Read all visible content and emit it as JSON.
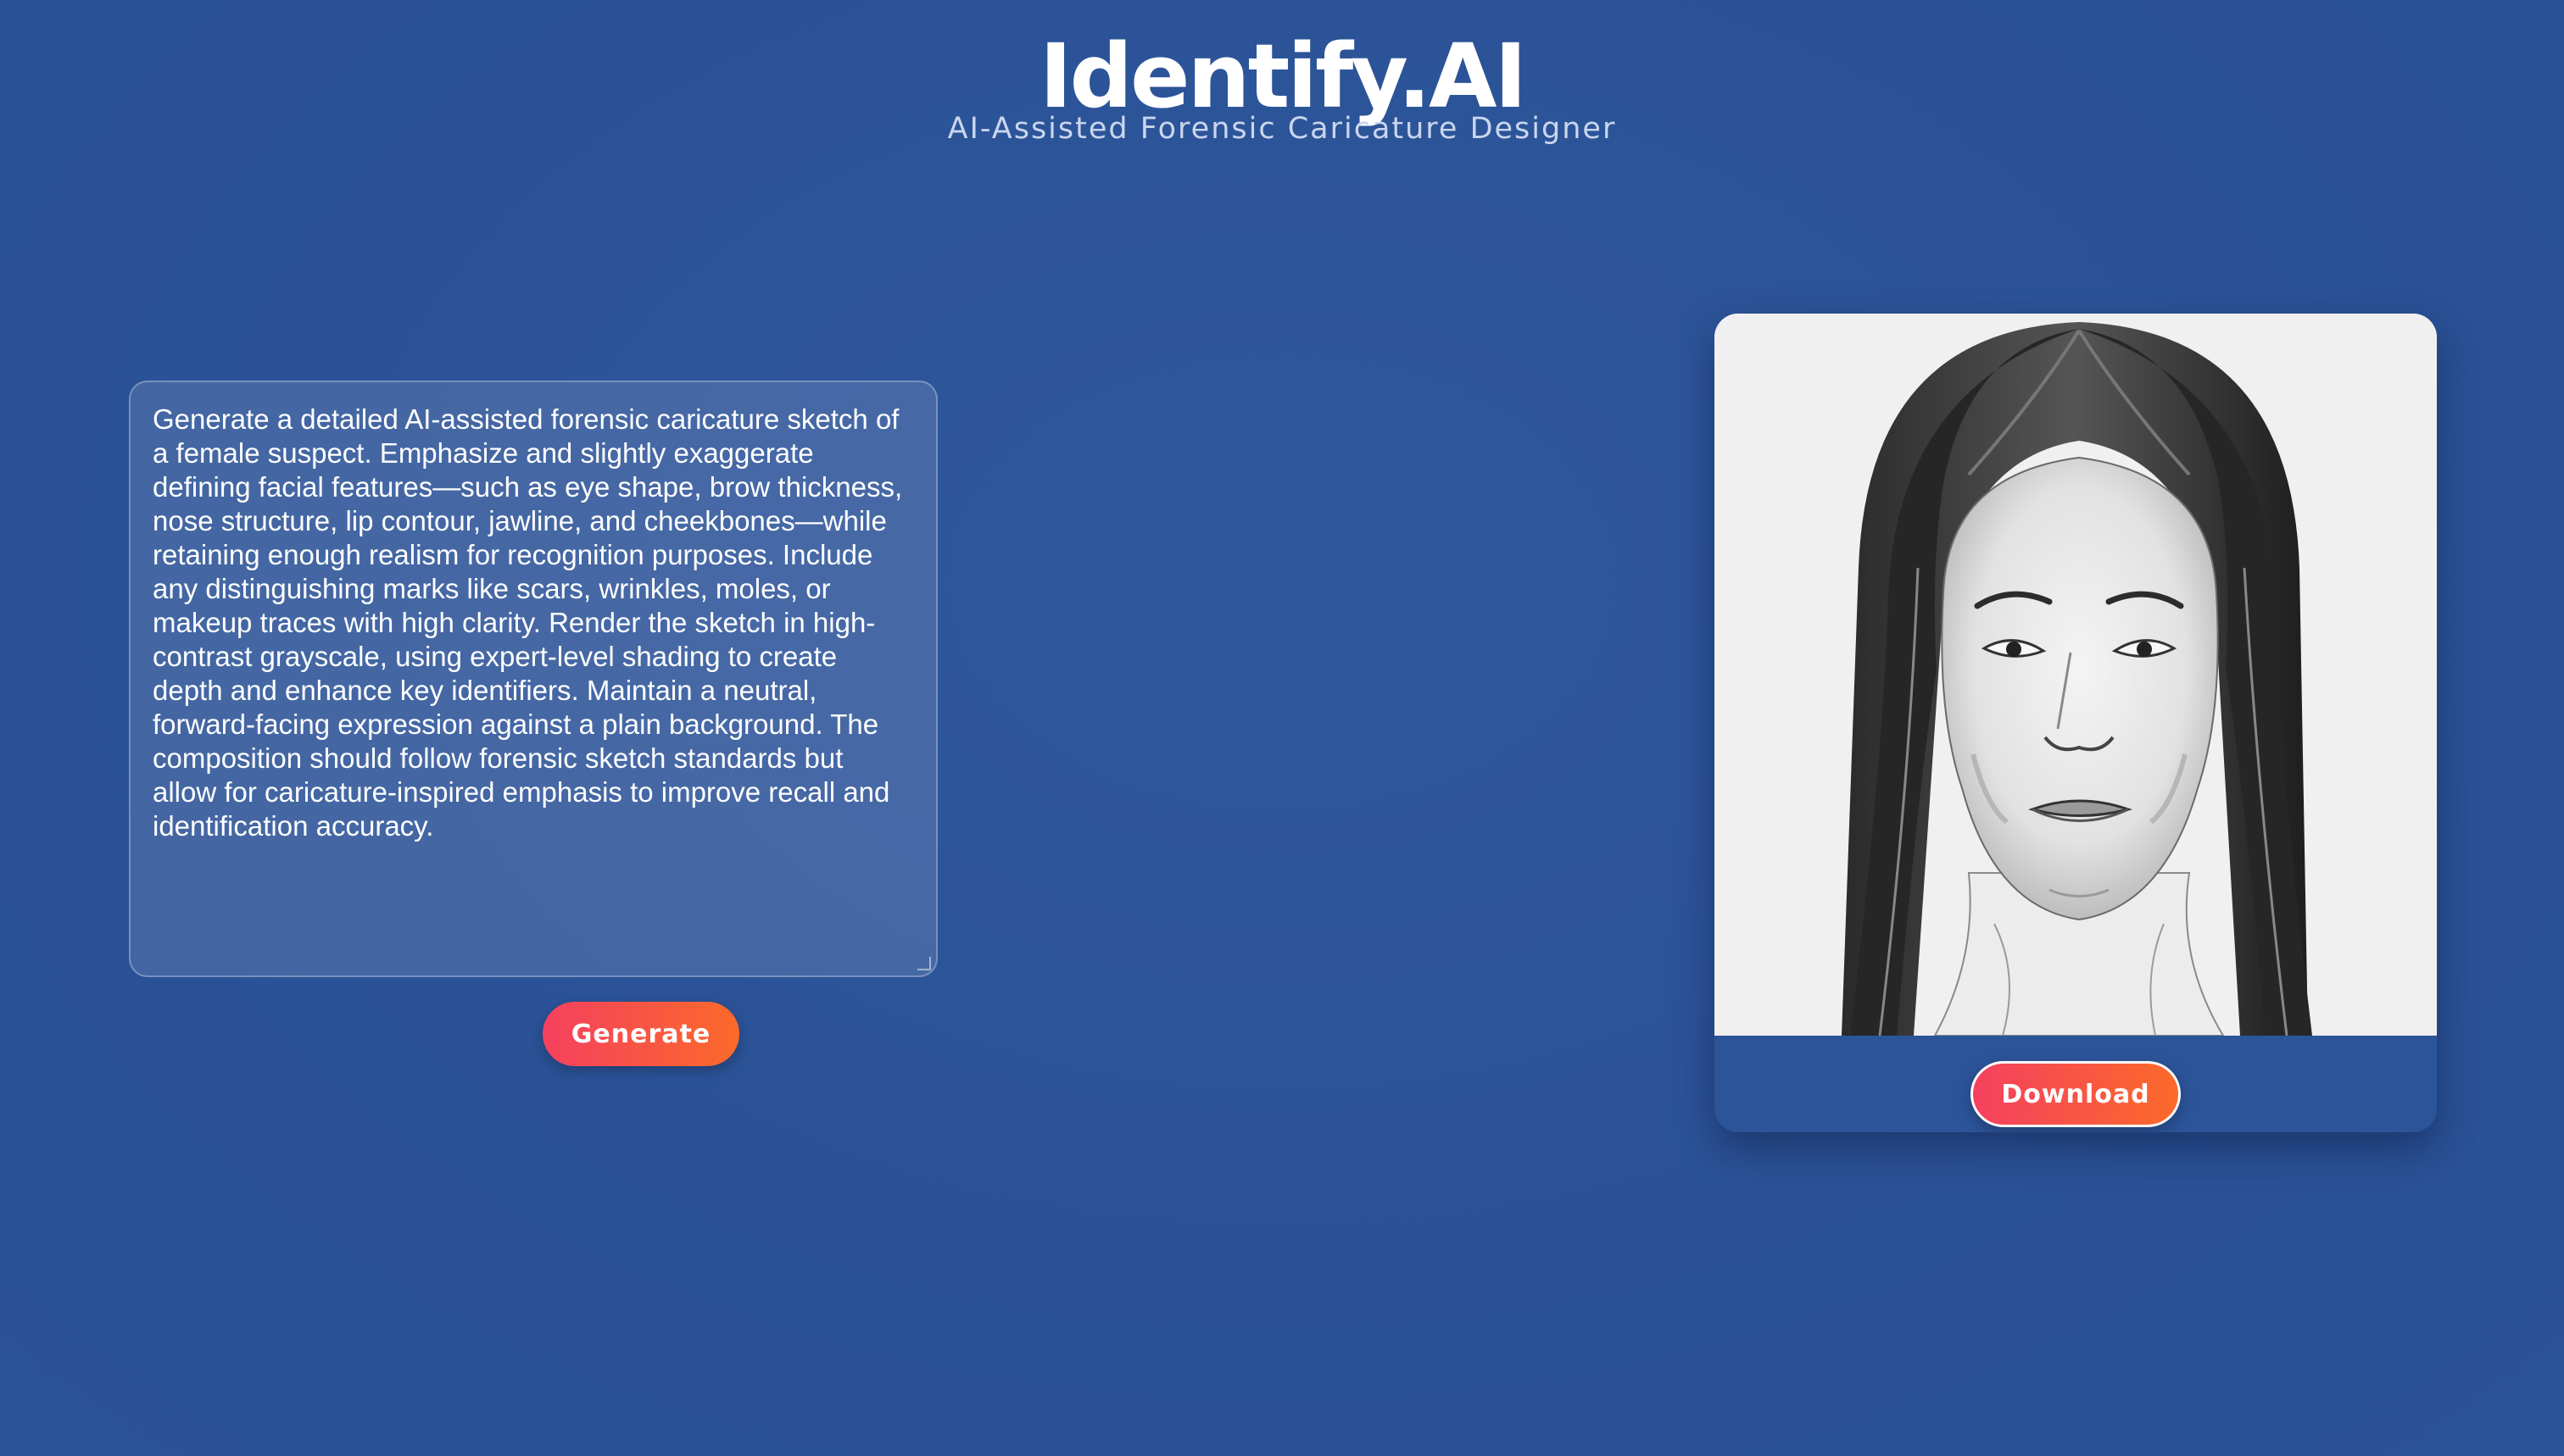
{
  "header": {
    "title": "Identify.AI",
    "subtitle": "AI-Assisted Forensic Caricature Designer"
  },
  "prompt": {
    "value": "Generate a detailed AI-assisted forensic caricature sketch of a female suspect. Emphasize and slightly exaggerate defining facial features—such as eye shape, brow thickness, nose structure, lip contour, jawline, and cheekbones—while retaining enough realism for recognition purposes. Include any distinguishing marks like scars, wrinkles, moles, or makeup traces with high clarity. Render the sketch in high-contrast grayscale, using expert-level shading to create depth and enhance key identifiers. Maintain a neutral, forward-facing expression against a plain background. The composition should follow forensic sketch standards but allow for caricature-inspired emphasis to improve recall and identification accuracy."
  },
  "actions": {
    "generate_label": "Generate",
    "download_label": "Download"
  },
  "colors": {
    "background": "#2c5499",
    "button_gradient_start": "#f5405f",
    "button_gradient_end": "#fb6a2a",
    "sketch_background": "#f1f1f1"
  }
}
